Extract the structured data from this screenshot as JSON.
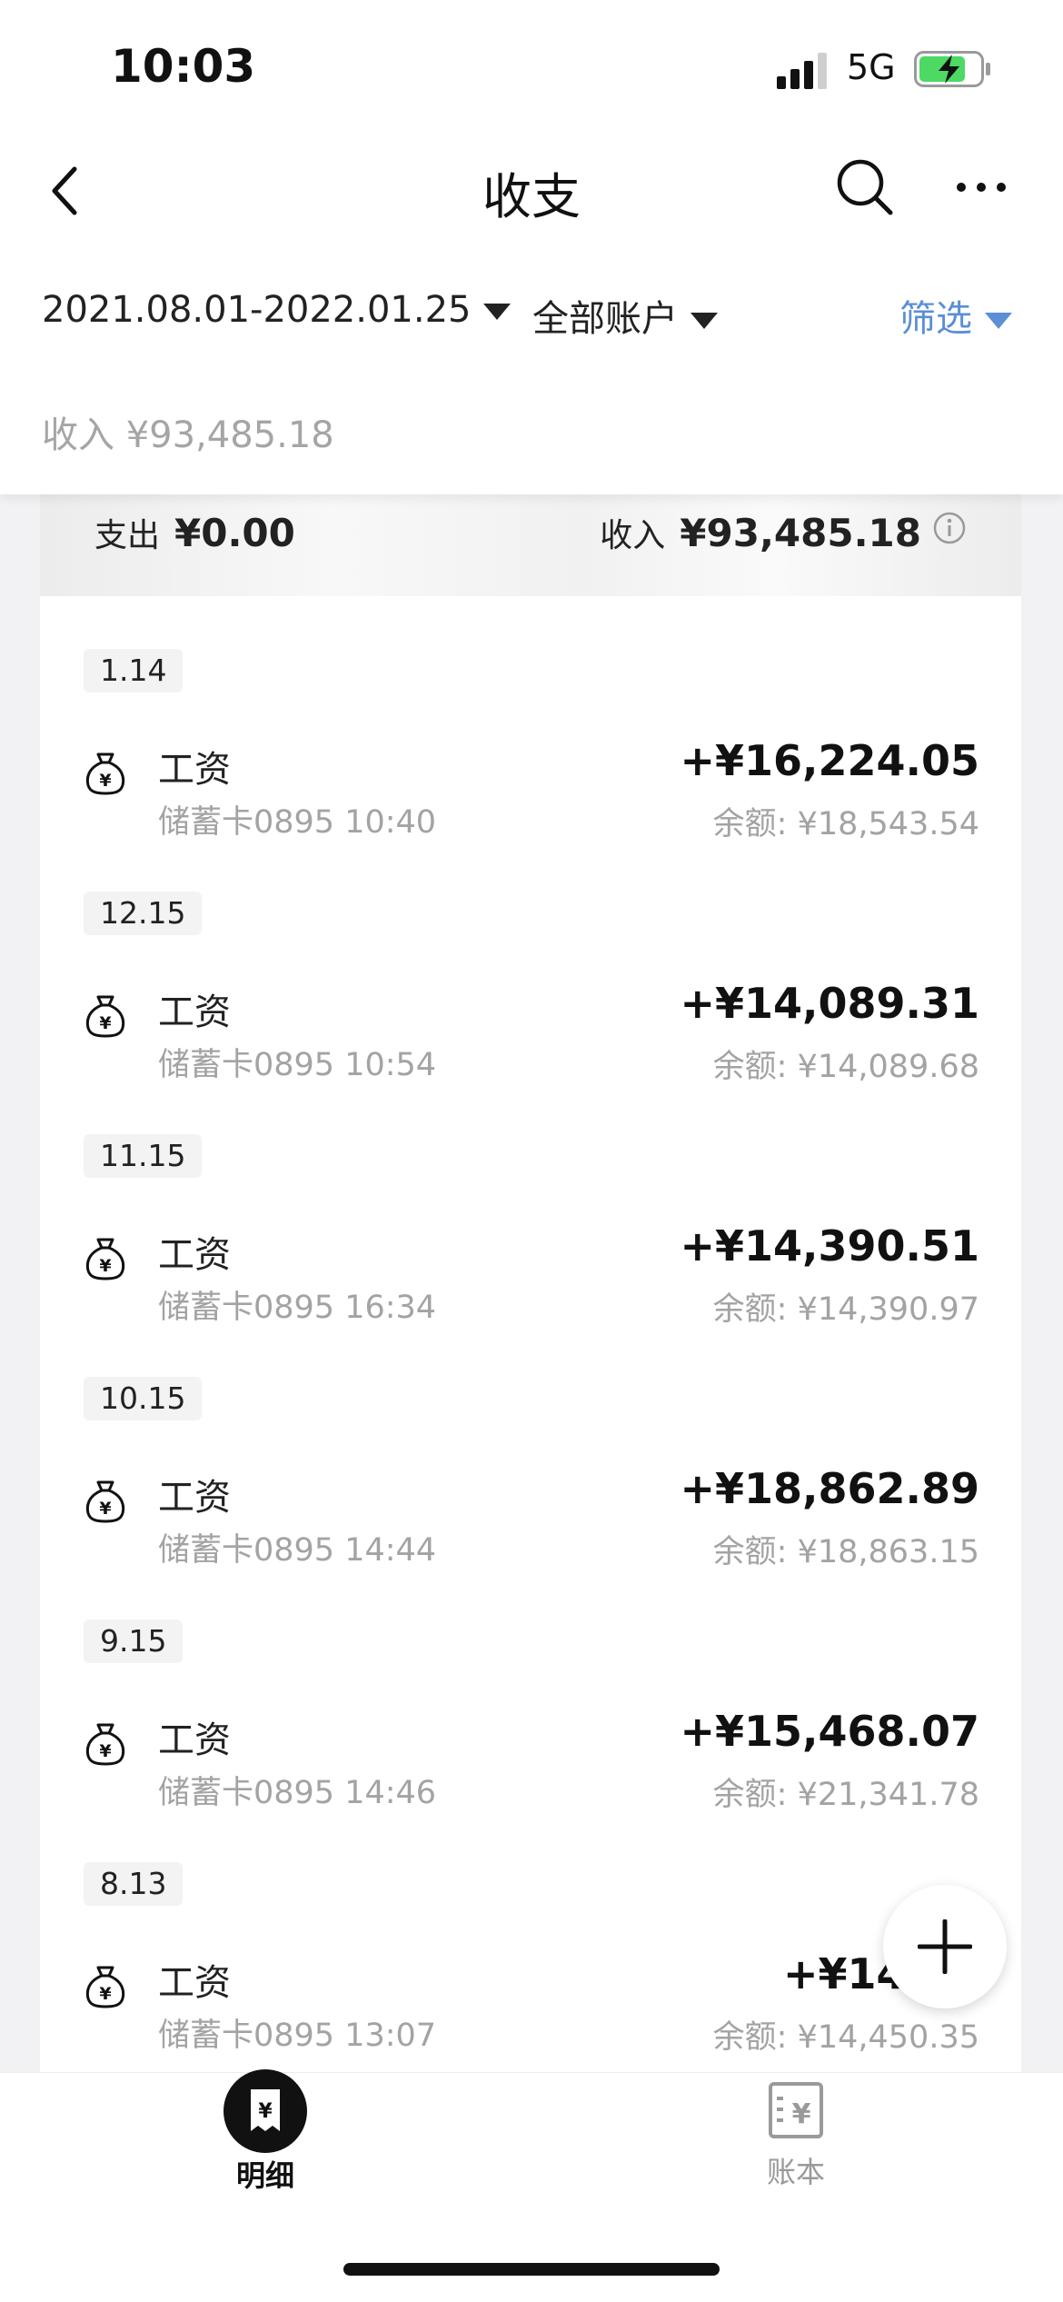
{
  "status_bar": {
    "time": "10:03",
    "network": "5G"
  },
  "nav": {
    "title": "收支"
  },
  "filters": {
    "date_range": "2021.08.01-2022.01.25",
    "account": "全部账户",
    "filter_label": "筛选"
  },
  "income_summary": "收入 ¥93,485.18",
  "banner": {
    "expense_label": "支出",
    "expense_value": "¥0.00",
    "income_label": "收入",
    "income_value": "¥93,485.18"
  },
  "transactions": [
    {
      "date": "1.14",
      "title": "工资",
      "subtitle": "储蓄卡0895 10:40",
      "amount": "+¥16,224.05",
      "balance": "余额: ¥18,543.54"
    },
    {
      "date": "12.15",
      "title": "工资",
      "subtitle": "储蓄卡0895 10:54",
      "amount": "+¥14,089.31",
      "balance": "余额: ¥14,089.68"
    },
    {
      "date": "11.15",
      "title": "工资",
      "subtitle": "储蓄卡0895 16:34",
      "amount": "+¥14,390.51",
      "balance": "余额: ¥14,390.97"
    },
    {
      "date": "10.15",
      "title": "工资",
      "subtitle": "储蓄卡0895 14:44",
      "amount": "+¥18,862.89",
      "balance": "余额: ¥18,863.15"
    },
    {
      "date": "9.15",
      "title": "工资",
      "subtitle": "储蓄卡0895 14:46",
      "amount": "+¥15,468.07",
      "balance": "余额: ¥21,341.78"
    },
    {
      "date": "8.13",
      "title": "工资",
      "subtitle": "储蓄卡0895 13:07",
      "amount": "+¥14,45",
      "balance": "余额: ¥14,450.35"
    }
  ],
  "tabs": {
    "details": "明细",
    "ledger": "账本"
  },
  "icons": {
    "back": "chevron-left-icon",
    "search": "search-icon",
    "more": "more-icon",
    "info": "info-icon",
    "income_bag": "money-bag-icon",
    "add": "plus-icon",
    "details_tab": "receipt-icon",
    "ledger_tab": "ledger-icon"
  },
  "colors": {
    "accent": "#5b8fd6",
    "battery": "#4cd964"
  }
}
